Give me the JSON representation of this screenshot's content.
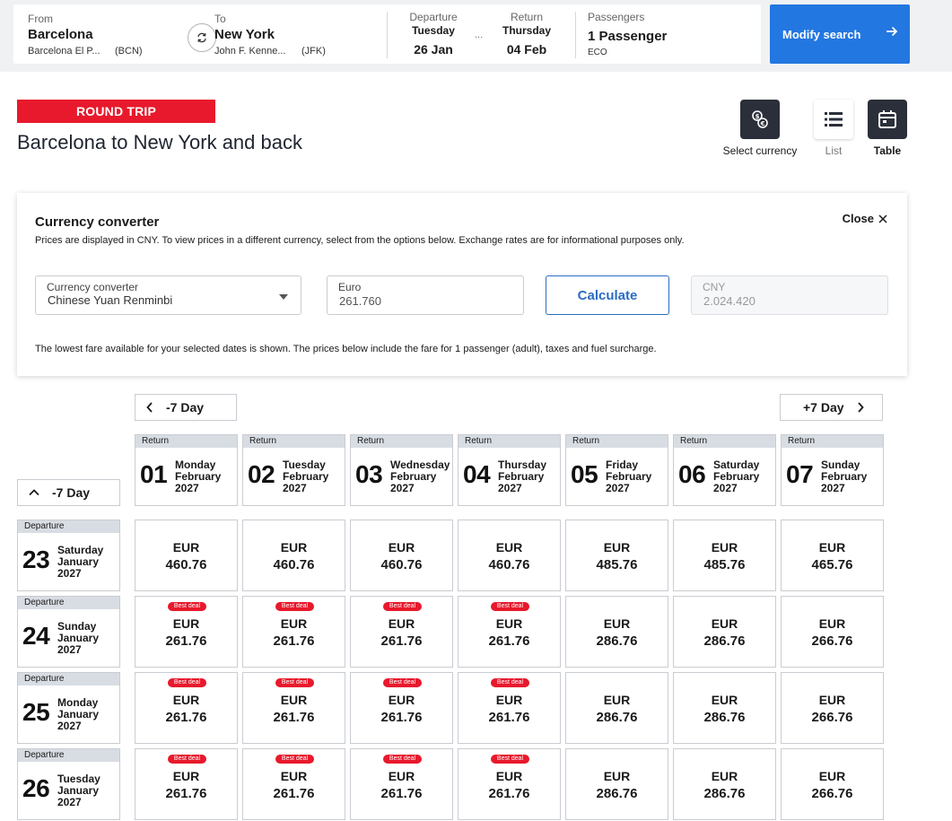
{
  "search": {
    "from_label": "From",
    "from_city": "Barcelona",
    "from_airport": "Barcelona El P...",
    "from_code": "(BCN)",
    "to_label": "To",
    "to_city": "New York",
    "to_airport": "John F. Kenne...",
    "to_code": "(JFK)",
    "departure_label": "Departure",
    "departure_weekday": "Tuesday",
    "departure_date": "26 Jan",
    "return_label": "Return",
    "return_weekday": "Thursday",
    "return_date": "04 Feb",
    "ellipsis": "...",
    "passengers_label": "Passengers",
    "passengers_value": "1 Passenger",
    "cabin": "ECO",
    "modify_label": "Modify search"
  },
  "heading": {
    "badge": "ROUND TRIP",
    "title": "Barcelona to New York and back"
  },
  "tools": {
    "currency_label": "Select currency",
    "list_label": "List",
    "table_label": "Table"
  },
  "converter": {
    "title": "Currency converter",
    "description": "Prices are displayed in CNY. To view prices in a different currency, select from the options below. Exchange rates are for informational purposes only.",
    "close_label": "Close",
    "select_label": "Currency converter",
    "select_value": "Chinese Yuan Renminbi",
    "from_label": "Euro",
    "from_value": "261.760",
    "calculate_label": "Calculate",
    "to_label": "CNY",
    "to_value": "2.024.420",
    "note": "The lowest fare available for your selected dates is shown. The prices below include the fare for 1 passenger (adult), taxes and fuel surcharge."
  },
  "calendar": {
    "prev_return_label": "-7 Day",
    "next_return_label": "+7 Day",
    "prev_departure_label": "-7 Day",
    "return_tag": "Return",
    "departure_tag": "Departure",
    "best_deal": "Best deal",
    "currency": "EUR",
    "returns": [
      {
        "day": "01",
        "weekday": "Monday",
        "month": "February",
        "year": "2027"
      },
      {
        "day": "02",
        "weekday": "Tuesday",
        "month": "February",
        "year": "2027"
      },
      {
        "day": "03",
        "weekday": "Wednesday",
        "month": "February",
        "year": "2027"
      },
      {
        "day": "04",
        "weekday": "Thursday",
        "month": "February",
        "year": "2027"
      },
      {
        "day": "05",
        "weekday": "Friday",
        "month": "February",
        "year": "2027"
      },
      {
        "day": "06",
        "weekday": "Saturday",
        "month": "February",
        "year": "2027"
      },
      {
        "day": "07",
        "weekday": "Sunday",
        "month": "February",
        "year": "2027"
      }
    ],
    "departures": [
      {
        "day": "23",
        "weekday": "Saturday",
        "month": "January",
        "year": "2027"
      },
      {
        "day": "24",
        "weekday": "Sunday",
        "month": "January",
        "year": "2027"
      },
      {
        "day": "25",
        "weekday": "Monday",
        "month": "January",
        "year": "2027"
      },
      {
        "day": "26",
        "weekday": "Tuesday",
        "month": "January",
        "year": "2027"
      }
    ],
    "prices": [
      [
        {
          "amount": "460.76",
          "best": false
        },
        {
          "amount": "460.76",
          "best": false
        },
        {
          "amount": "460.76",
          "best": false
        },
        {
          "amount": "460.76",
          "best": false
        },
        {
          "amount": "485.76",
          "best": false
        },
        {
          "amount": "485.76",
          "best": false
        },
        {
          "amount": "465.76",
          "best": false
        }
      ],
      [
        {
          "amount": "261.76",
          "best": true
        },
        {
          "amount": "261.76",
          "best": true
        },
        {
          "amount": "261.76",
          "best": true
        },
        {
          "amount": "261.76",
          "best": true
        },
        {
          "amount": "286.76",
          "best": false
        },
        {
          "amount": "286.76",
          "best": false
        },
        {
          "amount": "266.76",
          "best": false
        }
      ],
      [
        {
          "amount": "261.76",
          "best": true
        },
        {
          "amount": "261.76",
          "best": true
        },
        {
          "amount": "261.76",
          "best": true
        },
        {
          "amount": "261.76",
          "best": true
        },
        {
          "amount": "286.76",
          "best": false
        },
        {
          "amount": "286.76",
          "best": false
        },
        {
          "amount": "266.76",
          "best": false
        }
      ],
      [
        {
          "amount": "261.76",
          "best": true
        },
        {
          "amount": "261.76",
          "best": true
        },
        {
          "amount": "261.76",
          "best": true
        },
        {
          "amount": "261.76",
          "best": true
        },
        {
          "amount": "286.76",
          "best": false
        },
        {
          "amount": "286.76",
          "best": false
        },
        {
          "amount": "266.76",
          "best": false
        }
      ]
    ]
  },
  "colors": {
    "accent_blue": "#2377e0",
    "badge_red": "#e8192c",
    "tool_dark": "#2a2f3a"
  }
}
